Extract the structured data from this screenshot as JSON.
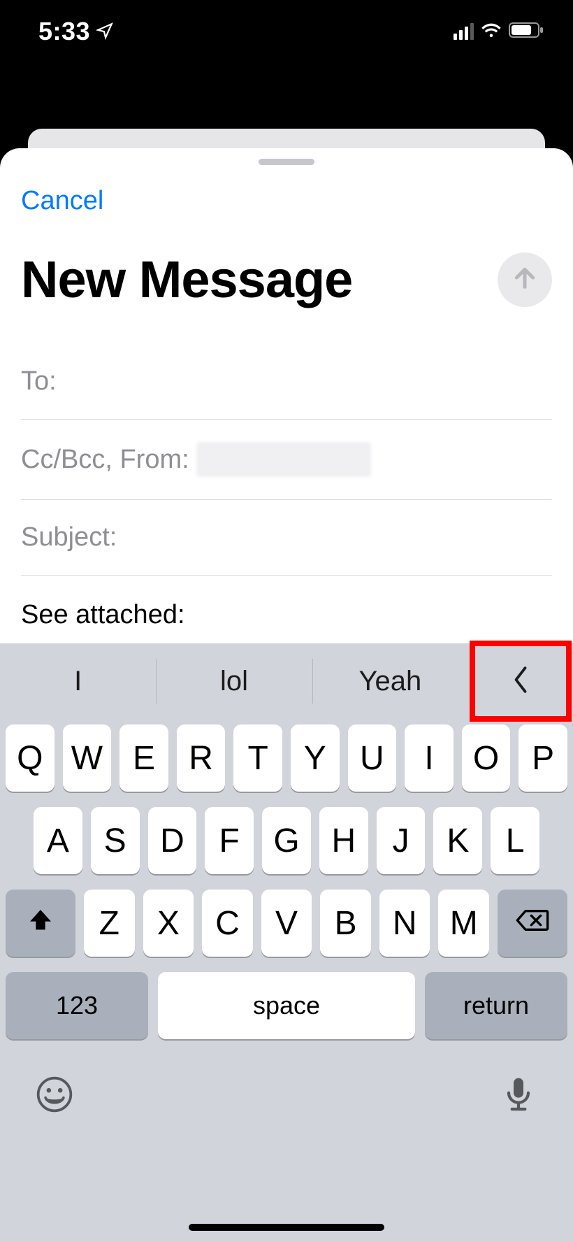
{
  "status_bar": {
    "time": "5:33"
  },
  "compose": {
    "cancel_label": "Cancel",
    "title": "New Message",
    "fields": {
      "to_label": "To:",
      "cc_label": "Cc/Bcc, From:",
      "subject_label": "Subject:"
    },
    "body_text": "See attached:"
  },
  "keyboard": {
    "suggestions": [
      "I",
      "lol",
      "Yeah"
    ],
    "row1": [
      "Q",
      "W",
      "E",
      "R",
      "T",
      "Y",
      "U",
      "I",
      "O",
      "P"
    ],
    "row2": [
      "A",
      "S",
      "D",
      "F",
      "G",
      "H",
      "J",
      "K",
      "L"
    ],
    "row3": [
      "Z",
      "X",
      "C",
      "V",
      "B",
      "N",
      "M"
    ],
    "numbers_label": "123",
    "space_label": "space",
    "return_label": "return"
  },
  "annotation": {
    "highlight_target": "suggestions-toggle"
  }
}
